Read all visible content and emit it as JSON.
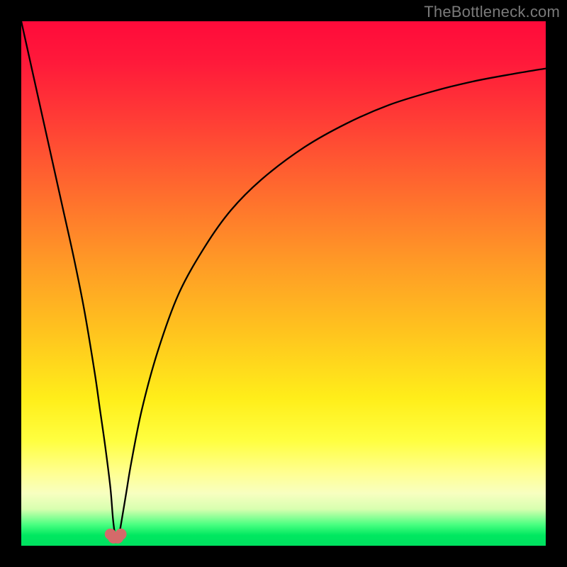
{
  "watermark": "TheBottleneck.com",
  "colors": {
    "frame": "#000000",
    "curve": "#000000",
    "marker": "#d46a6a",
    "watermark": "#7a7a7a"
  },
  "chart_data": {
    "type": "line",
    "title": "",
    "xlabel": "",
    "ylabel": "",
    "xlim": [
      0,
      100
    ],
    "ylim": [
      0,
      100
    ],
    "grid": false,
    "legend": false,
    "x_valley": 18,
    "series": [
      {
        "name": "bottleneck-curve",
        "x": [
          0,
          2,
          4,
          6,
          8,
          10,
          12,
          14,
          15,
          16,
          17,
          17.5,
          18,
          18.5,
          19,
          20,
          21,
          23,
          26,
          30,
          35,
          40,
          46,
          54,
          62,
          70,
          78,
          86,
          94,
          100
        ],
        "y": [
          100,
          91,
          82,
          73,
          64,
          55,
          45,
          33,
          26,
          19,
          11,
          5,
          1.5,
          1.5,
          4,
          10,
          16,
          26,
          37,
          48,
          57,
          64,
          70,
          76,
          80.5,
          84,
          86.5,
          88.5,
          90,
          91
        ]
      }
    ],
    "markers": {
      "x": [
        17.0,
        17.6,
        18.4,
        19.0
      ],
      "y": [
        2.2,
        1.5,
        1.5,
        2.2
      ]
    },
    "gradient_stops": [
      {
        "pct": 0,
        "color": "#ff0a3a"
      },
      {
        "pct": 8,
        "color": "#ff1a3a"
      },
      {
        "pct": 18,
        "color": "#ff3a36"
      },
      {
        "pct": 32,
        "color": "#ff6a2e"
      },
      {
        "pct": 46,
        "color": "#ff9a26"
      },
      {
        "pct": 60,
        "color": "#ffc61e"
      },
      {
        "pct": 72,
        "color": "#ffee1a"
      },
      {
        "pct": 80,
        "color": "#ffff40"
      },
      {
        "pct": 86,
        "color": "#ffff90"
      },
      {
        "pct": 90,
        "color": "#f8ffc0"
      },
      {
        "pct": 93,
        "color": "#d8ffb0"
      },
      {
        "pct": 96,
        "color": "#48ff80"
      },
      {
        "pct": 98,
        "color": "#00e860"
      },
      {
        "pct": 100,
        "color": "#00e060"
      }
    ]
  }
}
